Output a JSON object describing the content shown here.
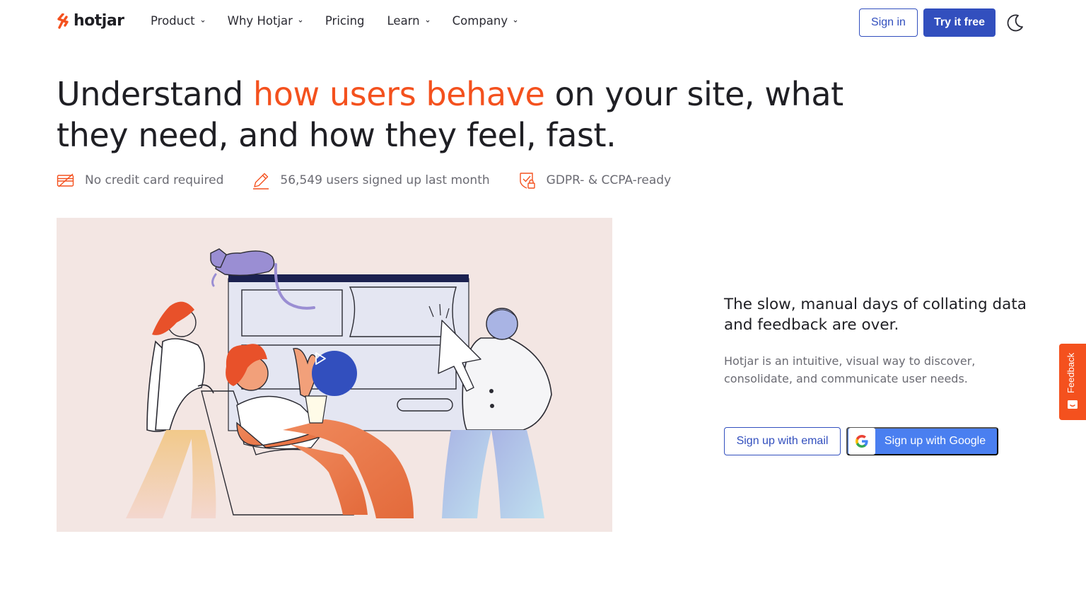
{
  "nav": {
    "logo_text": "hotjar",
    "items": [
      {
        "label": "Product",
        "has_dropdown": true
      },
      {
        "label": "Why Hotjar",
        "has_dropdown": true
      },
      {
        "label": "Pricing",
        "has_dropdown": false
      },
      {
        "label": "Learn",
        "has_dropdown": true
      },
      {
        "label": "Company",
        "has_dropdown": true
      }
    ],
    "sign_in": "Sign in",
    "try_free": "Try it free",
    "theme_icon": "moon-icon"
  },
  "hero": {
    "headline_pre": "Understand ",
    "headline_highlight": "how users behave",
    "headline_post": " on your site, what they need, and how they feel, fast.",
    "badges": [
      {
        "icon": "no-credit-card-icon",
        "text": "No credit card required"
      },
      {
        "icon": "pencil-icon",
        "text": "56,549 users signed up last month"
      },
      {
        "icon": "shield-lock-icon",
        "text": "GDPR- & CCPA-ready"
      }
    ]
  },
  "video": {
    "play_icon": "play-icon"
  },
  "signup": {
    "title": "The slow, manual days of collating data and feedback are over.",
    "description": "Hotjar is an intuitive, visual way to discover, consolidate, and communicate user needs.",
    "email_button": "Sign up with email",
    "google_button": "Sign up with Google"
  },
  "feedback_tab": {
    "label": "Feedback"
  },
  "colors": {
    "accent": "#f4511e",
    "primary": "#324fbe",
    "google_blue": "#4a7ff0",
    "hero_bg": "#f3e6e3"
  }
}
